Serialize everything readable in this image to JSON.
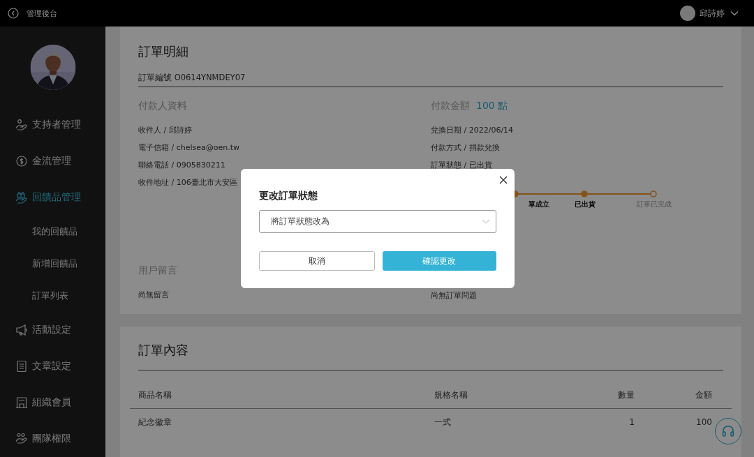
{
  "topbar": {
    "title": "管理後台",
    "user": "邱詩婷"
  },
  "sidebar": {
    "items": [
      {
        "label": "支持者管理",
        "selected": false
      },
      {
        "label": "金流管理",
        "selected": false
      },
      {
        "label": "回饋品管理",
        "selected": true,
        "children": [
          {
            "label": "我的回饋品",
            "selected": false
          },
          {
            "label": "新增回饋品",
            "selected": false
          },
          {
            "label": "訂單列表",
            "selected": false
          }
        ]
      },
      {
        "label": "活動設定",
        "selected": false
      },
      {
        "label": "文章設定",
        "selected": false
      },
      {
        "label": "組織會員",
        "selected": false
      },
      {
        "label": "團隊權限",
        "selected": false
      }
    ]
  },
  "order_detail": {
    "title": "訂單明細",
    "order_number": "訂單編號 O0614YNMDEY07",
    "payer": {
      "title": "付款人資料",
      "lines": [
        "收件人 / 邱詩婷",
        "電子信箱 / chelsea@oen.tw",
        "聯絡電話 / 0905830211",
        "收件地址 / 106臺北市大安區"
      ]
    },
    "payment": {
      "title": "付款金額",
      "amount": "100 點",
      "lines": [
        "兌換日期 / 2022/06/14",
        "付款方式 / 捐款兌換",
        "訂單狀態 / 已出貨"
      ]
    },
    "steps": [
      {
        "label": "單成立",
        "done": true
      },
      {
        "label": "已出貨",
        "done": true
      },
      {
        "label": "訂單已完成",
        "done": false
      }
    ],
    "message": {
      "title": "用戶留言",
      "text": "尚無留言"
    },
    "issue": {
      "text": "尚無訂單問題"
    }
  },
  "order_content": {
    "title": "訂單內容",
    "columns": [
      "商品名稱",
      "規格名稱",
      "數量",
      "金額"
    ],
    "rows": [
      [
        "紀念徽章",
        "一式",
        "1",
        "100"
      ]
    ]
  },
  "modal": {
    "title": "更改訂單狀態",
    "select": {
      "placeholder": "將訂單狀態改為"
    },
    "cancel": "取消",
    "confirm": "確認更改"
  }
}
